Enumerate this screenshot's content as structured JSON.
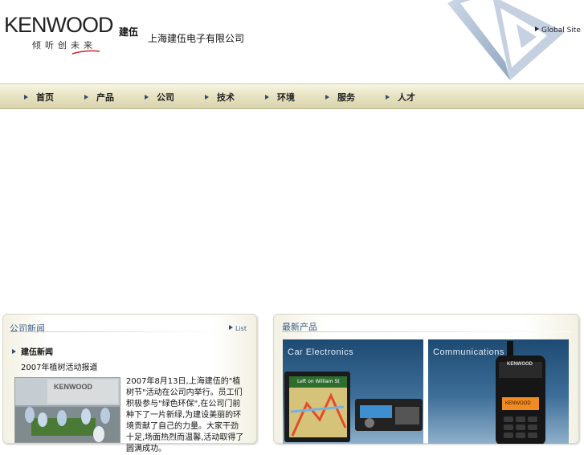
{
  "header": {
    "logo_word": "KENWOOD",
    "logo_cn": "建伍",
    "slogan": "倾听创未来",
    "company_name": "上海建伍电子有限公司",
    "global_link": "Global Site"
  },
  "nav": {
    "items": [
      {
        "label": "首页"
      },
      {
        "label": "产品"
      },
      {
        "label": "公司"
      },
      {
        "label": "技术"
      },
      {
        "label": "环境"
      },
      {
        "label": "服务"
      },
      {
        "label": "人才"
      }
    ]
  },
  "news": {
    "title": "公司新闻",
    "list_link": "List",
    "headline": "建伍新闻",
    "subline": "2007年植树活动报道",
    "photo_logo": "KENWOOD",
    "body": "2007年8月13日,上海建伍的\"植树节\"活动在公司内举行。员工们积极参与\"绿色环保\",在公司门前种下了一片新绿,为建设美丽的环境贡献了自己的力量。大家干劲十足,场面热烈而温馨,活动取得了圆满成功。"
  },
  "products": {
    "title": "最新产品",
    "tiles": [
      {
        "label": "Car Electronics",
        "sign_text": "Left on William St"
      },
      {
        "label": "Communications",
        "radio_brand": "KENWOOD",
        "radio_display": "KENWOOD"
      }
    ]
  },
  "colors": {
    "nav_gradient_top": "#f7f5e4",
    "nav_gradient_bottom": "#d9d4ad",
    "panel_title": "#3d5a86",
    "tile_blue": "#1d4a72"
  }
}
